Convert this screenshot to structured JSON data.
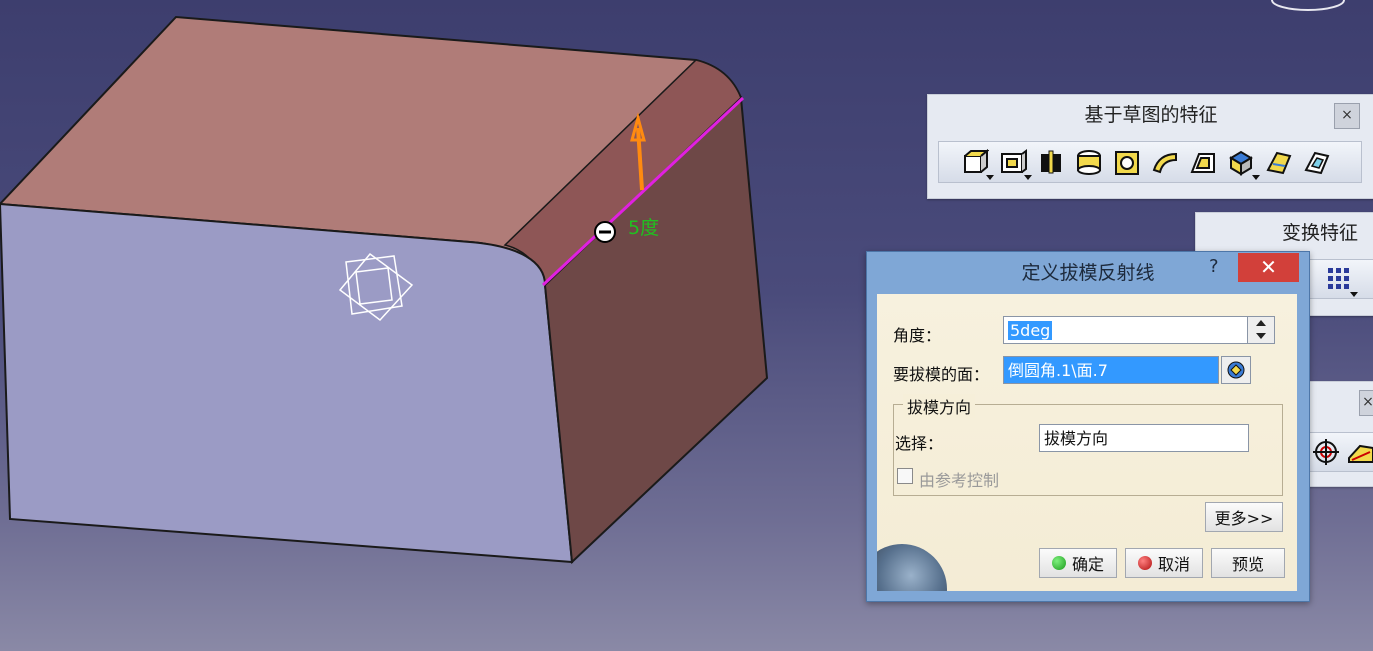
{
  "toolbar_sketch_features": {
    "title": "基于草图的特征",
    "close_label": "×",
    "icons": [
      "pad-icon",
      "pocket-icon",
      "shaft-icon",
      "groove-icon",
      "hole-icon",
      "rib-icon",
      "slot-icon",
      "stiffener-icon",
      "multi-section-solid-icon",
      "removed-multi-section-icon"
    ]
  },
  "toolbar_transform": {
    "title": "变换特征",
    "close_label": "×"
  },
  "dialog": {
    "title": "定义拔模反射线",
    "help_label": "?",
    "close_label": "✕",
    "angle_label": "角度：",
    "angle_value": "5deg",
    "face_label": "要拔模的面：",
    "face_value": "倒圆角.1\\面.7",
    "direction_group": "拔模方向",
    "select_label": "选择：",
    "select_value": "拔模方向",
    "ref_control_label": "由参考控制",
    "more_button": "更多>>",
    "ok_button": "确定",
    "cancel_button": "取消",
    "preview_button": "预览"
  },
  "model": {
    "angle_annotation": "5度"
  },
  "colors": {
    "background_top": "#3d3e6e",
    "top_face": "#b07c78",
    "front_face": "#9b9bc5",
    "side_face": "#6e4847",
    "reflect_line": "#e020e0",
    "direction_arrow": "#ff8a10",
    "annotation": "#20c020",
    "dialog_frame": "#7fa7d6",
    "dialog_body": "#f4ecd5",
    "close_red": "#d2403a"
  }
}
